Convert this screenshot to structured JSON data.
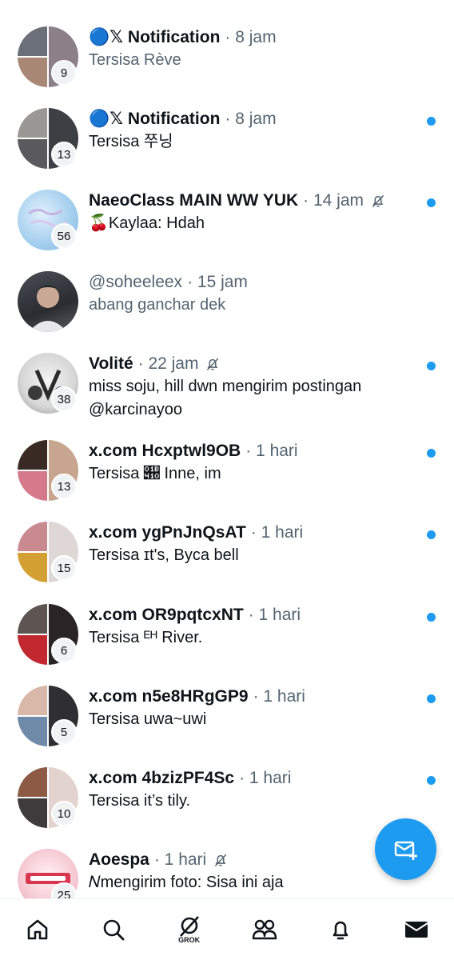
{
  "conversations": [
    {
      "name": "🔵𝕏 Notification",
      "time": "· 8 jam",
      "preview": "Tersisa Rève",
      "count": "9",
      "unread": false,
      "muted": false,
      "preview_muted": true
    },
    {
      "name": "🔵𝕏 Notification",
      "time": "· 8 jam",
      "preview": "Tersisa 쭈닝",
      "count": "13",
      "unread": true,
      "muted": false
    },
    {
      "name": "NaeoClass MAIN WW YUK",
      "time": "· 14 jam",
      "preview": "🍒Kaylaa: Hdah",
      "count": "56",
      "unread": true,
      "muted": true
    },
    {
      "name": "",
      "handle": "@soheeleex",
      "time": "· 15 jam",
      "preview": "abang ganchar dek",
      "count": "",
      "unread": false,
      "muted": false,
      "preview_muted": true
    },
    {
      "name": "Volité",
      "time": "· 22 jam",
      "preview": "miss soju, hill dwn mengirim postingan",
      "preview2": "@karcinayoo",
      "count": "38",
      "unread": true,
      "muted": true
    },
    {
      "name": "x.com Hcxptwl9OB",
      "time": "· 1 hari",
      "preview": "Tersisa 𛐐 Inne, im",
      "count": "13",
      "unread": true,
      "muted": false
    },
    {
      "name": "x.com ygPnJnQsAT",
      "time": "· 1 hari",
      "preview": "Tersisa ɪt's, Byca bell",
      "count": "15",
      "unread": true,
      "muted": false
    },
    {
      "name": "x.com OR9pqtcxNT",
      "time": "· 1 hari",
      "preview": "Tersisa ᴱᴴ River.",
      "count": "6",
      "unread": true,
      "muted": false
    },
    {
      "name": "x.com n5e8HRgGP9",
      "time": "· 1 hari",
      "preview": "Tersisa uwa~uwi",
      "count": "5",
      "unread": true,
      "muted": false
    },
    {
      "name": "x.com 4bzizPF4Sc",
      "time": "· 1 hari",
      "preview": "Tersisa it’s tily.",
      "count": "10",
      "unread": true,
      "muted": false
    },
    {
      "name": "Aoespa",
      "time": "· 1 hari",
      "preview": "𝑁mengirim foto: Sisa ini aja",
      "count": "25",
      "unread": false,
      "muted": true
    }
  ],
  "nav": {
    "items": [
      {
        "icon": "home-icon"
      },
      {
        "icon": "search-icon"
      },
      {
        "icon": "grok-icon",
        "label": "GROK"
      },
      {
        "icon": "communities-icon"
      },
      {
        "icon": "bell-icon"
      },
      {
        "icon": "mail-icon"
      }
    ]
  },
  "fab": {
    "icon": "new-message-icon"
  },
  "colors": {
    "accent": "#1d9bf0",
    "text": "#0f1419",
    "secondary": "#536471",
    "badge_bg": "#eff3f4"
  }
}
